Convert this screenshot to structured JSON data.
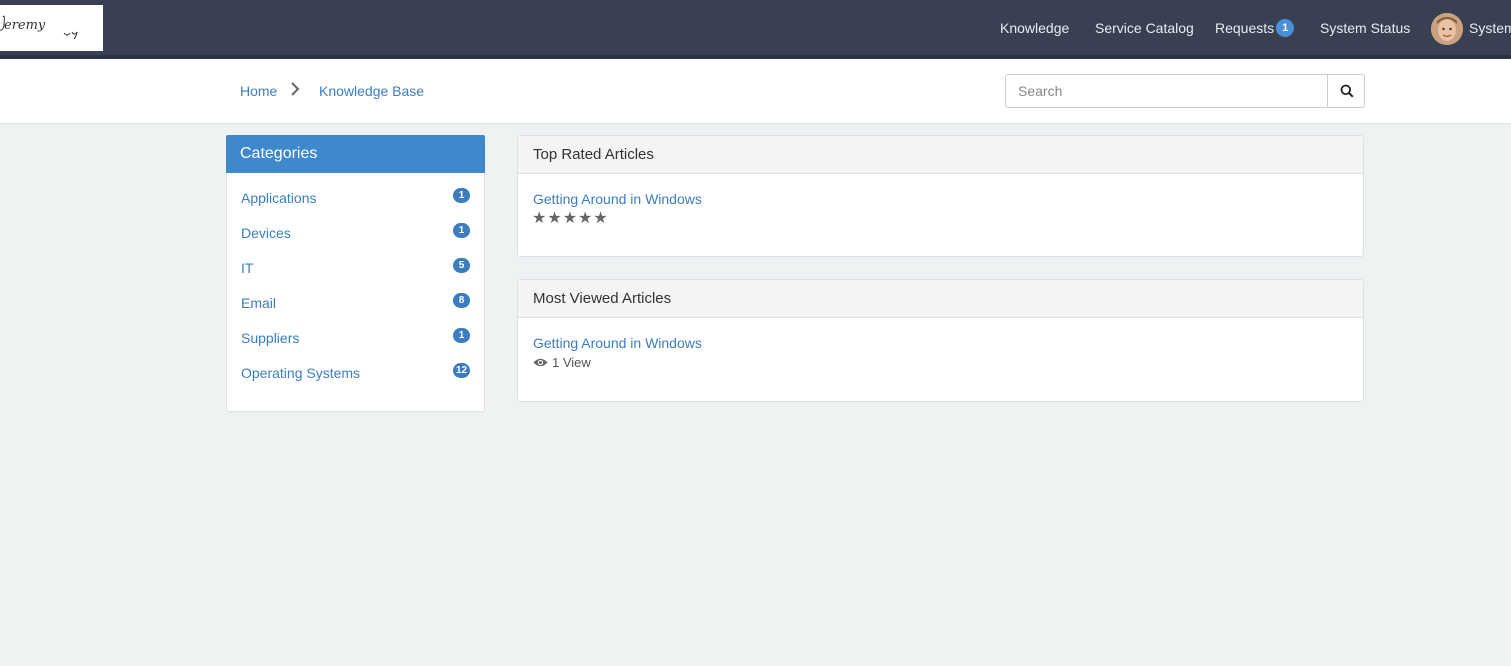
{
  "logo_text": "Jeremy",
  "nav": {
    "items": [
      {
        "label": "Knowledge"
      },
      {
        "label": "Service Catalog"
      },
      {
        "label": "Requests",
        "badge": "1"
      },
      {
        "label": "System Status"
      }
    ],
    "user_label": "System"
  },
  "breadcrumb": {
    "home": "Home",
    "current": "Knowledge Base"
  },
  "search": {
    "placeholder": "Search"
  },
  "categories": {
    "title": "Categories",
    "items": [
      {
        "label": "Applications",
        "count": "1"
      },
      {
        "label": "Devices",
        "count": "1"
      },
      {
        "label": "IT",
        "count": "5"
      },
      {
        "label": "Email",
        "count": "8"
      },
      {
        "label": "Suppliers",
        "count": "1"
      },
      {
        "label": "Operating Systems",
        "count": "12"
      }
    ]
  },
  "top_rated": {
    "title": "Top Rated Articles",
    "article": "Getting Around in Windows",
    "stars": "★★★★★"
  },
  "most_viewed": {
    "title": "Most Viewed Articles",
    "article": "Getting Around in Windows",
    "views": "1 View"
  },
  "colors": {
    "nav_bg": "#384052",
    "accent": "#4088cc",
    "link": "#3b7dbf"
  }
}
